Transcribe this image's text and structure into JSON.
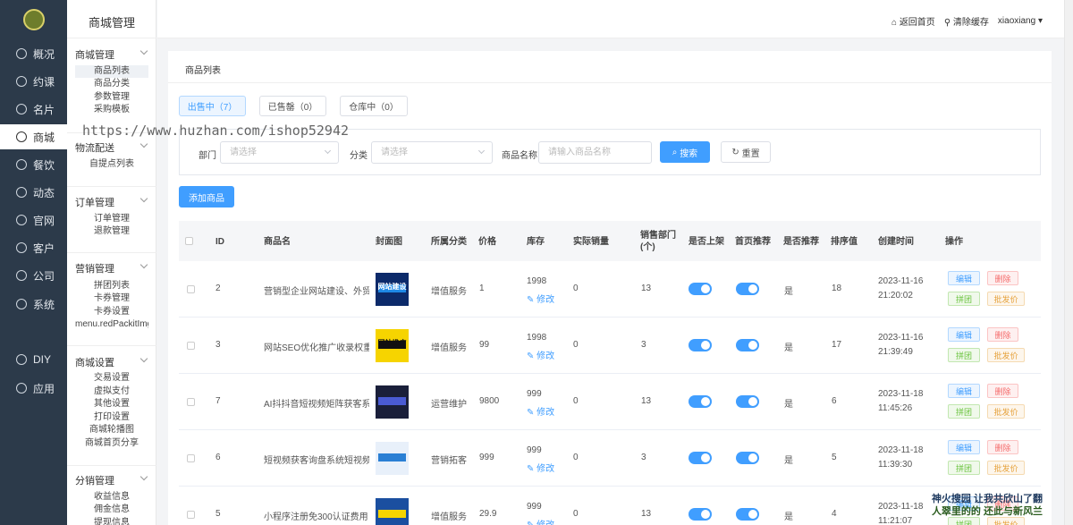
{
  "nav": {
    "items": [
      {
        "label": "概况",
        "icon": "pie-chart-icon"
      },
      {
        "label": "约课",
        "icon": "calendar-icon"
      },
      {
        "label": "名片",
        "icon": "card-icon"
      },
      {
        "label": "商城",
        "icon": "shop-icon"
      },
      {
        "label": "餐饮",
        "icon": "food-icon"
      },
      {
        "label": "动态",
        "icon": "compass-icon"
      },
      {
        "label": "官网",
        "icon": "globe-icon"
      },
      {
        "label": "客户",
        "icon": "user-icon"
      },
      {
        "label": "公司",
        "icon": "company-icon"
      },
      {
        "label": "系统",
        "icon": "settings-icon"
      },
      {
        "label": "DIY",
        "icon": "diy-icon"
      },
      {
        "label": "应用",
        "icon": "apps-icon"
      }
    ]
  },
  "sub": {
    "title": "商城管理",
    "groups": [
      {
        "title": "商城管理",
        "items": [
          "商品列表",
          "商品分类",
          "参数管理",
          "采购模板"
        ]
      },
      {
        "title": "物流配送",
        "items": [
          "自提点列表"
        ]
      },
      {
        "title": "订单管理",
        "items": [
          "订单管理",
          "退款管理"
        ]
      },
      {
        "title": "营销管理",
        "items": [
          "拼团列表",
          "卡券管理",
          "卡券设置",
          "menu.redPackitImgSet"
        ]
      },
      {
        "title": "商城设置",
        "items": [
          "交易设置",
          "虚拟支付",
          "其他设置",
          "打印设置",
          "商城轮播图",
          "商城首页分享"
        ]
      },
      {
        "title": "分销管理",
        "items": [
          "收益信息",
          "佣金信息",
          "提现信息"
        ]
      }
    ]
  },
  "topbar": {
    "home": "返回首页",
    "clear_cache": "清除缓存",
    "user": "xiaoxiang"
  },
  "breadcrumb": "商品列表",
  "tabs": [
    "出售中（7）",
    "已售罄（0）",
    "仓库中（0）"
  ],
  "filter": {
    "dept_label": "部门",
    "dept_placeholder": "请选择",
    "cat_label": "分类",
    "cat_placeholder": "请选择",
    "name_label": "商品名称",
    "name_placeholder": "请输入商品名称",
    "search": "搜索",
    "reset": "重置"
  },
  "add_button": "添加商品",
  "table": {
    "headers": [
      "ID",
      "商品名",
      "封面图",
      "所属分类",
      "价格",
      "库存",
      "实际销量",
      "销售部门(个)",
      "是否上架",
      "首页推荐",
      "是否推荐",
      "排序值",
      "创建时间",
      "操作"
    ],
    "edit_link": "修改",
    "actions": {
      "edit": "编辑",
      "delete": "删除",
      "group": "拼团",
      "batch": "批发价"
    },
    "rows": [
      {
        "id": "2",
        "name": "营销型企业网站建设、外贸...",
        "category": "增值服务",
        "price": "1",
        "stock": "1998",
        "sales": "0",
        "depts": "13",
        "recommend": "是",
        "sort": "18",
        "date": "2023-11-16",
        "time": "21:20:02",
        "cover": "网站建设"
      },
      {
        "id": "3",
        "name": "网站SEO优化推广收录权重...",
        "category": "增值服务",
        "price": "99",
        "stock": "1998",
        "sales": "0",
        "depts": "3",
        "recommend": "是",
        "sort": "17",
        "date": "2023-11-16",
        "time": "21:39:49",
        "cover": "网站推广"
      },
      {
        "id": "7",
        "name": "AI抖抖音短视频矩阵获客系...",
        "category": "运营维护",
        "price": "9800",
        "stock": "999",
        "sales": "0",
        "depts": "13",
        "recommend": "是",
        "sort": "6",
        "date": "2023-11-18",
        "time": "11:45:26",
        "cover": ""
      },
      {
        "id": "6",
        "name": "短视频获客询盘系统短视频...",
        "category": "营销拓客",
        "price": "999",
        "stock": "999",
        "sales": "0",
        "depts": "3",
        "recommend": "是",
        "sort": "5",
        "date": "2023-11-18",
        "time": "11:39:30",
        "cover": ""
      },
      {
        "id": "5",
        "name": "小程序注册免300认证费用",
        "category": "增值服务",
        "price": "29.9",
        "stock": "999",
        "sales": "0",
        "depts": "13",
        "recommend": "是",
        "sort": "4",
        "date": "2023-11-18",
        "time": "11:21:07",
        "cover": ""
      }
    ]
  },
  "watermark": "https://www.huzhan.com/ishop52942",
  "watermark2": [
    "神火搜园 让我共欣山了翻",
    "人翠里的的 还此与新风兰"
  ]
}
